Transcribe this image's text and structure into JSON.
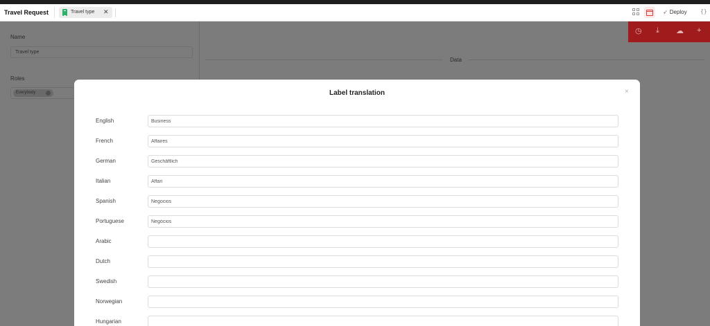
{
  "header": {
    "app_title": "Travel Request",
    "tab": {
      "label": "Travel type",
      "close": "✕",
      "icon": "sheet-icon"
    },
    "deploy_label": "Deploy",
    "code_glyph": "{}",
    "icons": [
      "grid-icon",
      "calendar-icon",
      "rocket-icon",
      "code-icon"
    ]
  },
  "left_panel": {
    "name_label": "Name",
    "name_value": "Travel type",
    "roles_label": "Roles",
    "role_chip": "Everybody"
  },
  "action_bar": {
    "icons": [
      "history-icon",
      "download-icon",
      "cloud-upload-icon",
      "plus-icon"
    ],
    "accent_color": "#c62828"
  },
  "data_section": {
    "label": "Data"
  },
  "modal": {
    "title": "Label translation",
    "close": "×",
    "rows": [
      {
        "language": "English",
        "value": "Business"
      },
      {
        "language": "French",
        "value": "Affaires"
      },
      {
        "language": "German",
        "value": "Geschäftlich"
      },
      {
        "language": "Italian",
        "value": "Affari"
      },
      {
        "language": "Spanish",
        "value": "Negocios"
      },
      {
        "language": "Portuguese",
        "value": "Negócios"
      },
      {
        "language": "Arabic",
        "value": ""
      },
      {
        "language": "Dutch",
        "value": ""
      },
      {
        "language": "Swedish",
        "value": ""
      },
      {
        "language": "Norwegian",
        "value": ""
      },
      {
        "language": "Hungarian",
        "value": ""
      }
    ]
  }
}
